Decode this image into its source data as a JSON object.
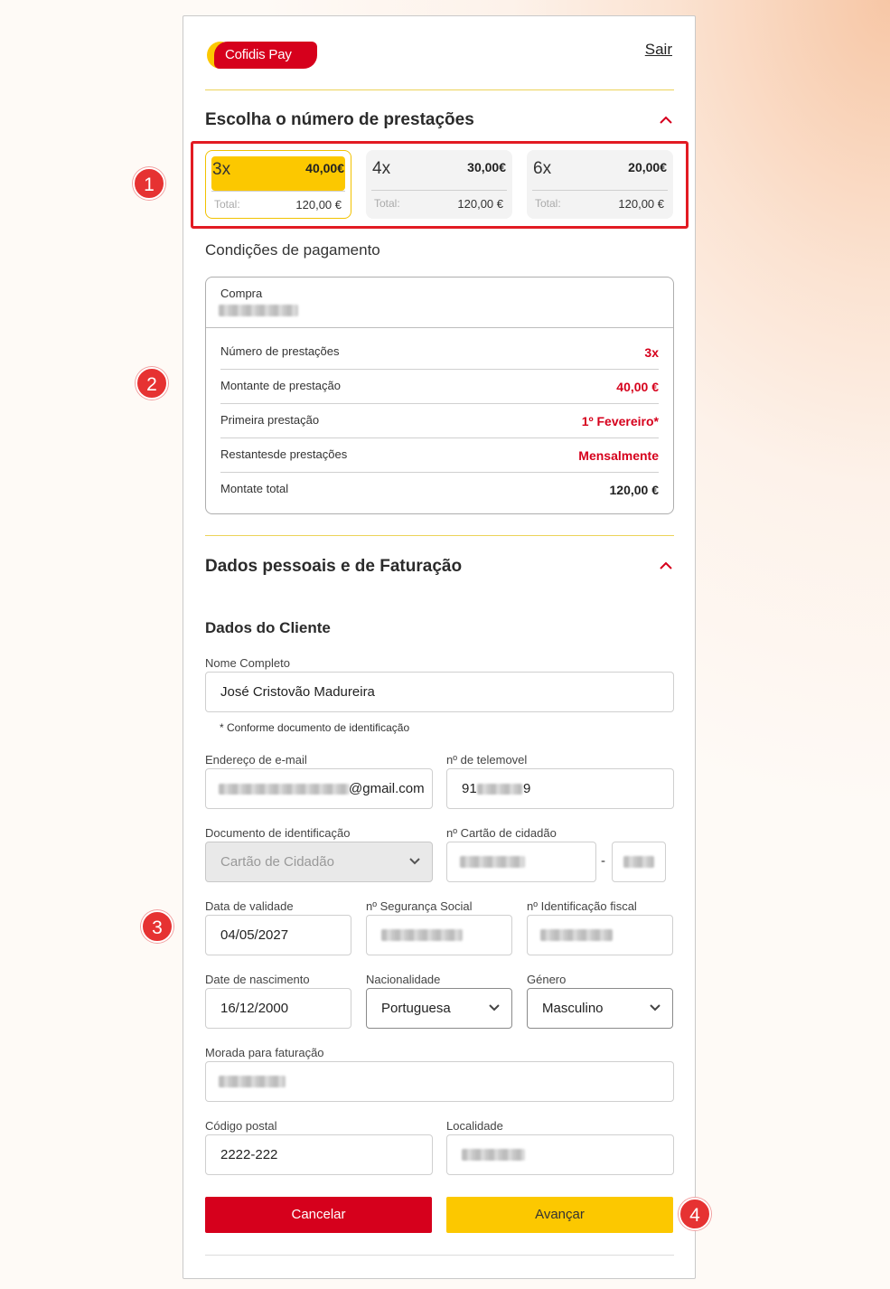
{
  "header": {
    "logo_text": "Cofidis Pay",
    "exit_link": "Sair"
  },
  "installments": {
    "title": "Escolha o número de prestações",
    "options": [
      {
        "count": "3x",
        "amount": "40,00€",
        "total_label": "Total:",
        "total": "120,00 €",
        "selected": true
      },
      {
        "count": "4x",
        "amount": "30,00€",
        "total_label": "Total:",
        "total": "120,00 €",
        "selected": false
      },
      {
        "count": "6x",
        "amount": "20,00€",
        "total_label": "Total:",
        "total": "120,00 €",
        "selected": false
      }
    ]
  },
  "conditions": {
    "title": "Condições de pagamento",
    "purchase_label": "Compra",
    "rows": [
      {
        "label": "Número de prestações",
        "value": "3x"
      },
      {
        "label": "Montante de prestação",
        "value": "40,00 €"
      },
      {
        "label": "Primeira prestação",
        "value": "1º Fevereiro*"
      },
      {
        "label": "Restantesde prestações",
        "value": "Mensalmente"
      },
      {
        "label": "Montate total",
        "value": "120,00 €"
      }
    ]
  },
  "personal": {
    "title": "Dados pessoais e de Faturação",
    "subtitle": "Dados do Cliente",
    "full_name": {
      "label": "Nome Completo",
      "value": "José Cristovão Madureira"
    },
    "id_note": "* Conforme documento de identificação",
    "email": {
      "label": "Endereço de e-mail",
      "value": "@gmail.com"
    },
    "phone": {
      "label": "nº de telemovel",
      "prefix": "91",
      "suffix": "9"
    },
    "doc_type": {
      "label": "Documento de identificação",
      "value": "Cartão de Cidadão"
    },
    "cc_number": {
      "label": "nº Cartão de cidadão",
      "separator": "-"
    },
    "validity": {
      "label": "Data de validade",
      "value": "04/05/2027"
    },
    "social_security": {
      "label": "nº Segurança Social"
    },
    "tax_id": {
      "label": "nº Identificação fiscal"
    },
    "birth_date": {
      "label": "Date de nascimento",
      "value": "16/12/2000"
    },
    "nationality": {
      "label": "Nacionalidade",
      "value": "Portuguesa"
    },
    "gender": {
      "label": "Género",
      "value": "Masculino"
    },
    "billing_address": {
      "label": "Morada para faturação"
    },
    "postal_code": {
      "label": "Código postal",
      "value": "2222-222"
    },
    "locality": {
      "label": "Localidade"
    }
  },
  "actions": {
    "cancel": "Cancelar",
    "next": "Avançar"
  },
  "markers": [
    "1",
    "2",
    "3",
    "4"
  ],
  "colors": {
    "brand_red": "#d6001c",
    "brand_yellow": "#fcc800",
    "highlight": "#e21b23"
  }
}
